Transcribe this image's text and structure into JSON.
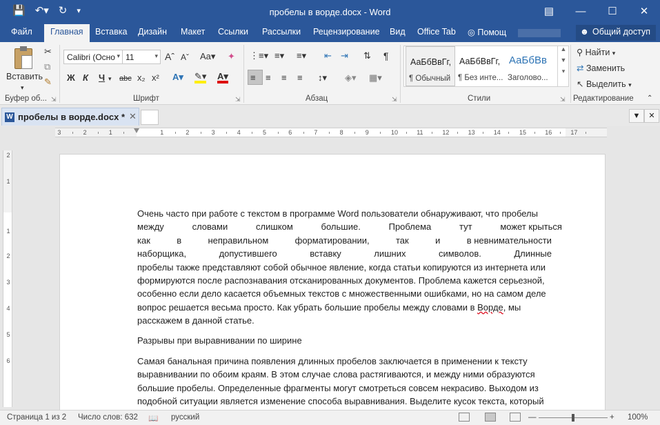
{
  "titlebar": {
    "title": "пробелы в ворде.docx - Word",
    "qat": [
      "save-icon",
      "undo-icon",
      "redo-icon",
      "customize-icon"
    ],
    "controls": [
      "ribbon-display-icon",
      "minimize-icon",
      "maximize-icon",
      "close-icon"
    ]
  },
  "tabs": {
    "file": "Файл",
    "items": [
      "Главная",
      "Вставка",
      "Дизайн",
      "Макет",
      "Ссылки",
      "Рассылки",
      "Рецензирование",
      "Вид",
      "Office Tab"
    ],
    "tell_me": "Помощ",
    "share": "Общий доступ"
  },
  "ribbon": {
    "clipboard": {
      "paste": "Вставить",
      "label": "Буфер об..."
    },
    "font": {
      "name": "Calibri (Осно",
      "size": "11",
      "label": "Шрифт",
      "bold": "Ж",
      "italic": "К",
      "underline": "Ч",
      "strike": "abc",
      "sub": "x₂",
      "sup": "x²"
    },
    "paragraph": {
      "label": "Абзац"
    },
    "styles": {
      "label": "Стили",
      "items": [
        {
          "sample": "АаБбВвГг,",
          "name": "¶ Обычный"
        },
        {
          "sample": "АаБбВвГг,",
          "name": "¶ Без инте..."
        },
        {
          "sample": "АаБбВв",
          "name": "Заголово..."
        }
      ]
    },
    "editing": {
      "find": "Найти",
      "replace": "Заменить",
      "select": "Выделить",
      "label": "Редактирование"
    }
  },
  "doctab": {
    "label": "пробелы в ворде.docx *"
  },
  "ruler": {
    "h": [
      "3",
      "2",
      "1",
      "1",
      "2",
      "3",
      "4",
      "5",
      "6",
      "7",
      "8",
      "9",
      "10",
      "11",
      "12",
      "13",
      "14",
      "15",
      "16",
      "17"
    ],
    "v": [
      "2",
      "1",
      "1",
      "2",
      "3",
      "4",
      "5",
      "6"
    ]
  },
  "document": {
    "p1": [
      [
        "Очень часто при работе с текстом в программе Word пользователи обнаруживают, что пробелы"
      ],
      [
        "между",
        "словами",
        "слишком",
        "большие.",
        "Проблема",
        "тут",
        "может крыться"
      ],
      [
        "как",
        "в",
        "неправильном",
        "форматировании,",
        "так",
        "и",
        "в невнимательности"
      ],
      [
        "наборщика,",
        "допустившего",
        "вставку",
        "лишних",
        "символов.",
        "Длинные"
      ],
      [
        "пробелы также представляют собой обычное явление, когда статьи копируются из интернета или"
      ],
      [
        "формируются после распознавания отсканированных документов. Проблема кажется серьезной,"
      ],
      [
        "особенно если дело касается объемных текстов с множественными ошибками, но на самом деле"
      ],
      [
        "вопрос решается весьма просто. Как убрать большие пробелы между словами в Ворде, мы"
      ],
      [
        "расскажем в данной статье."
      ]
    ],
    "p2": "Разрывы при выравнивании по ширине",
    "p3": [
      "Самая банальная причина появления длинных пробелов заключается в применении к тексту",
      "выравнивании по обоим краям. В этом случае слова растягиваются, и между ними образуются",
      "большие пробелы. Определенные фрагменты могут смотреться совсем некрасиво. Выходом из",
      "подобной ситуации является изменение способа выравнивания. Выделите кусок текста, который"
    ]
  },
  "statusbar": {
    "page": "Страница 1 из 2",
    "words": "Число слов: 632",
    "lang": "русский",
    "zoom": "100%",
    "zoom_value": 100
  }
}
